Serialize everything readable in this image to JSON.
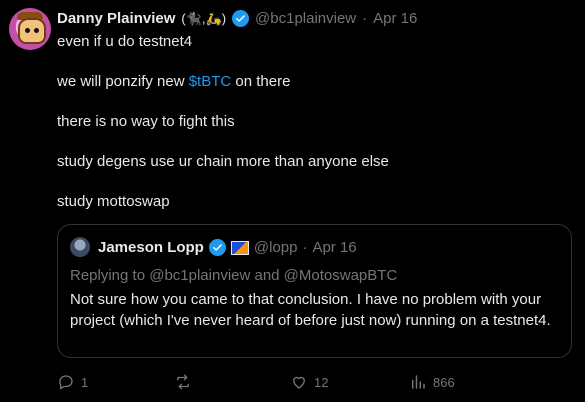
{
  "tweet": {
    "author_name": "Danny Plainview",
    "author_emoji": "(🐈‍⬛,🛵)",
    "handle": "@bc1plainview",
    "date": "Apr 16",
    "lines": [
      "even if u do testnet4",
      "",
      "there is no way to fight this",
      "study degens use ur chain more than anyone else",
      "study mottoswap"
    ],
    "line2_prefix": "we will ponzify new ",
    "line2_cashtag": "$tBTC",
    "line2_suffix": " on there"
  },
  "quote": {
    "author_name": "Jameson Lopp",
    "handle": "@lopp",
    "date": "Apr 16",
    "replying_to": "Replying to @bc1plainview and @MotoswapBTC",
    "text": "Not sure how you came to that conclusion. I have no problem with your project (which I've never heard of before just now) running on a testnet4."
  },
  "actions": {
    "replies": "1",
    "reposts": "",
    "likes": "12",
    "views": "866"
  },
  "colors": {
    "background": "#000000",
    "text": "#e7e9ea",
    "muted": "#71767b",
    "accent": "#1d9bf0",
    "border": "#2f3336"
  }
}
